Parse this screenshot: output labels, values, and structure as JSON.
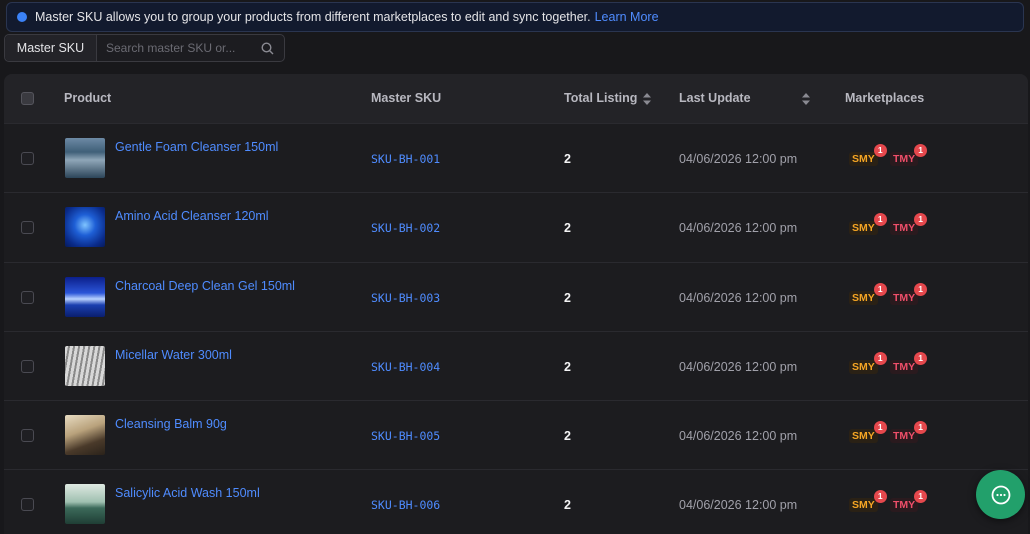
{
  "banner": {
    "text": "Master SKU allows you to group your products from different marketplaces to edit and sync together.",
    "link": "Learn More"
  },
  "search": {
    "selector_label": "Master SKU",
    "placeholder": "Search master SKU or...",
    "value": ""
  },
  "table": {
    "columns": {
      "product": "Product",
      "master_sku": "Master SKU",
      "total_listing": "Total Listing",
      "last_update": "Last Update",
      "marketplaces": "Marketplaces"
    },
    "rows": [
      {
        "name": "Gentle Foam Cleanser 150ml",
        "sku": "SKU-BH-001",
        "total": "2",
        "updated": "04/06/2026 12:00 pm",
        "smy": "SMY",
        "smy_count": "1",
        "tmy": "TMY",
        "tmy_count": "1",
        "thumb": "waves"
      },
      {
        "name": "Amino Acid Cleanser 120ml",
        "sku": "SKU-BH-002",
        "total": "2",
        "updated": "04/06/2026 12:00 pm",
        "smy": "SMY",
        "smy_count": "1",
        "tmy": "TMY",
        "tmy_count": "1",
        "thumb": "underwater"
      },
      {
        "name": "Charcoal Deep Clean Gel 150ml",
        "sku": "SKU-BH-003",
        "total": "2",
        "updated": "04/06/2026 12:00 pm",
        "smy": "SMY",
        "smy_count": "1",
        "tmy": "TMY",
        "tmy_count": "1",
        "thumb": "horizon"
      },
      {
        "name": "Micellar Water 300ml",
        "sku": "SKU-BH-004",
        "total": "2",
        "updated": "04/06/2026 12:00 pm",
        "smy": "SMY",
        "smy_count": "1",
        "tmy": "TMY",
        "tmy_count": "1",
        "thumb": "architecture"
      },
      {
        "name": "Cleansing Balm 90g",
        "sku": "SKU-BH-005",
        "total": "2",
        "updated": "04/06/2026 12:00 pm",
        "smy": "SMY",
        "smy_count": "1",
        "tmy": "TMY",
        "tmy_count": "1",
        "thumb": "cliff"
      },
      {
        "name": "Salicylic Acid Wash 150ml",
        "sku": "SKU-BH-006",
        "total": "2",
        "updated": "04/06/2026 12:00 pm",
        "smy": "SMY",
        "smy_count": "1",
        "tmy": "TMY",
        "tmy_count": "1",
        "thumb": "dock"
      }
    ]
  },
  "colors": {
    "link": "#4f8cff",
    "smy": "#f5a524",
    "tmy": "#ef4f6a",
    "badge": "#e5484d",
    "chat": "#22a06b"
  },
  "icons": {
    "info": "info-icon",
    "search": "search-icon",
    "sort": "sort-icon",
    "chat": "chat-icon"
  }
}
